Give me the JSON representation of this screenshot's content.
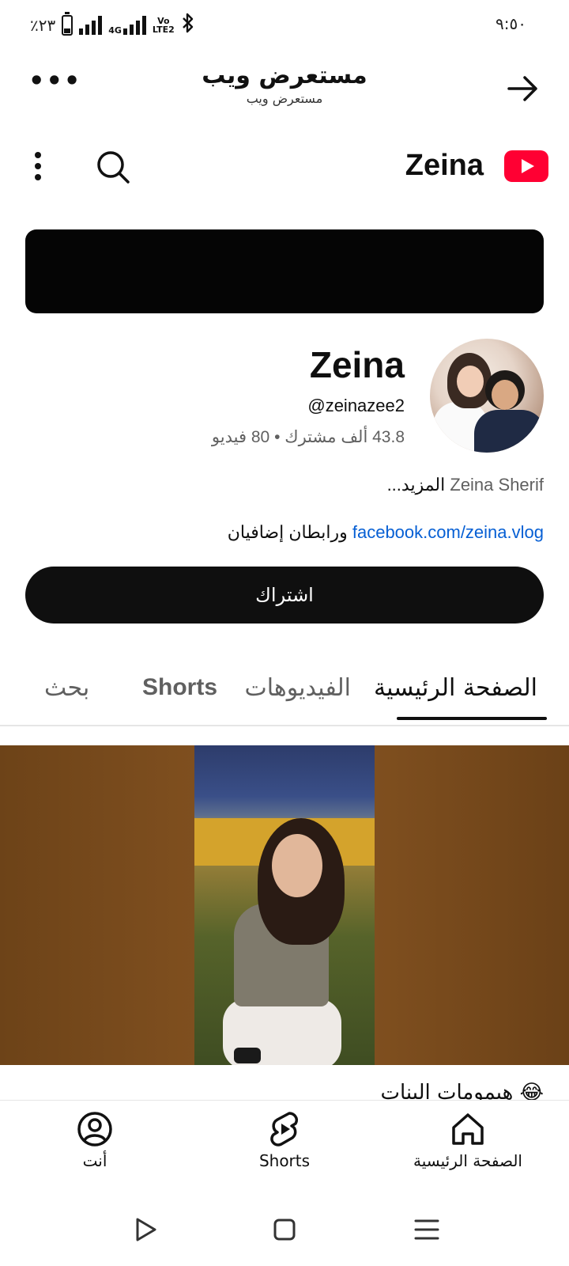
{
  "status_bar": {
    "battery_text": "٪٢٣",
    "network_4g": "4G",
    "network_volte_1": "Vo",
    "network_volte_2": "LTE2",
    "time": "٩:٥٠"
  },
  "browser": {
    "title": "مستعرض ويب",
    "subtitle": "مستعرض ويب"
  },
  "youtube_bar": {
    "channel_title": "Zeina"
  },
  "channel": {
    "name": "Zeina",
    "handle": "@zeinazee2",
    "subscribers": "43.8 ألف مشترك",
    "separator": "•",
    "videos": "80 فيديو",
    "description": "Zeina Sherif",
    "more_label": "...المزيد",
    "link": "facebook.com/zeina.vlog",
    "extra_links": "ورابطان إضافيان",
    "subscribe_label": "اشتراك"
  },
  "tabs": [
    {
      "label": "الصفحة الرئيسية",
      "active": true
    },
    {
      "label": "الفيديوهات",
      "active": false
    },
    {
      "label": "Shorts",
      "active": false
    },
    {
      "label": "بحث",
      "active": false
    }
  ],
  "featured_video": {
    "title_peek": "هيمومات البنات 😂"
  },
  "bottom_nav": [
    {
      "label": "الصفحة الرئيسية",
      "icon": "home-icon"
    },
    {
      "label": "Shorts",
      "icon": "shorts-icon"
    },
    {
      "label": "أنت",
      "icon": "account-icon"
    }
  ],
  "system_nav": [
    "recent-apps-icon",
    "home-square-icon",
    "back-triangle-icon"
  ],
  "colors": {
    "youtube_red": "#ff0033",
    "link_blue": "#065fd4",
    "subscribe_bg": "#0f0f0f",
    "video_bg": "#7a4c1d"
  }
}
